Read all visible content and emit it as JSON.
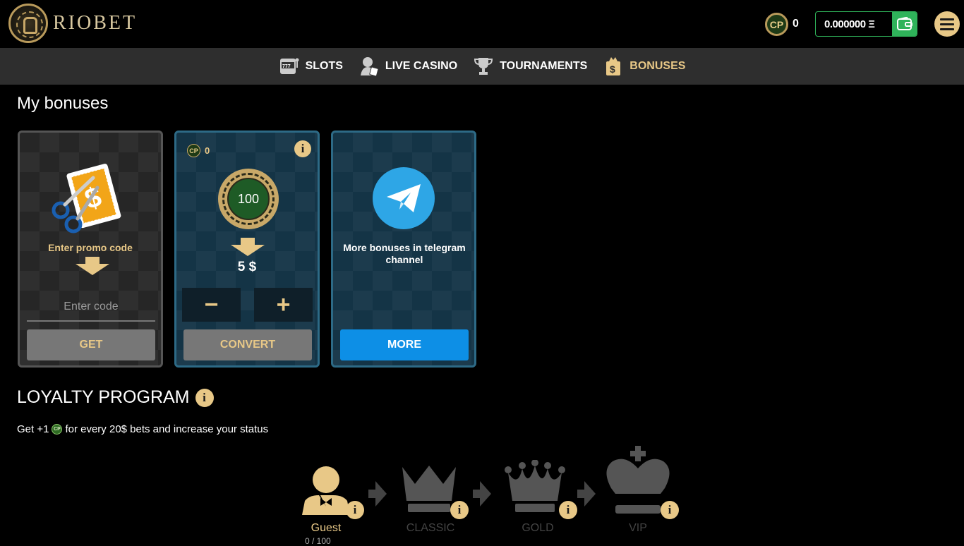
{
  "header": {
    "brand": "RIOBET",
    "cp_label": "CP",
    "cp_count": "0",
    "balance": "0.000000 Ξ"
  },
  "nav": {
    "items": [
      {
        "label": "SLOTS",
        "icon": "slot-machine-icon"
      },
      {
        "label": "LIVE CASINO",
        "icon": "dealer-icon"
      },
      {
        "label": "TOURNAMENTS",
        "icon": "trophy-icon"
      },
      {
        "label": "BONUSES",
        "icon": "bonus-bag-icon",
        "active": true
      }
    ]
  },
  "main": {
    "title": "My bonuses",
    "promo": {
      "label": "Enter promo code",
      "placeholder": "Enter code",
      "button": "GET"
    },
    "convert": {
      "cp_label": "CP",
      "cp_value": "0",
      "chip_value": "100",
      "result": "5 $",
      "minus": "−",
      "plus": "+",
      "button": "CONVERT"
    },
    "telegram": {
      "text": "More bonuses in telegram channel",
      "button": "MORE"
    }
  },
  "loyalty": {
    "title": "LOYALTY PROGRAM",
    "desc_prefix": "Get +1",
    "cp_label": "CP",
    "desc_suffix": "for every 20$ bets and increase your status",
    "levels": [
      {
        "label": "Guest",
        "active": true,
        "progress": "0 / 100"
      },
      {
        "label": "CLASSIC",
        "active": false
      },
      {
        "label": "GOLD",
        "active": false
      },
      {
        "label": "VIP",
        "active": false
      }
    ]
  },
  "colors": {
    "gold": "#e8c887",
    "green": "#2fb35a",
    "blue": "#0d8fe6",
    "teal_card": "#143446",
    "inactive": "#555555"
  }
}
